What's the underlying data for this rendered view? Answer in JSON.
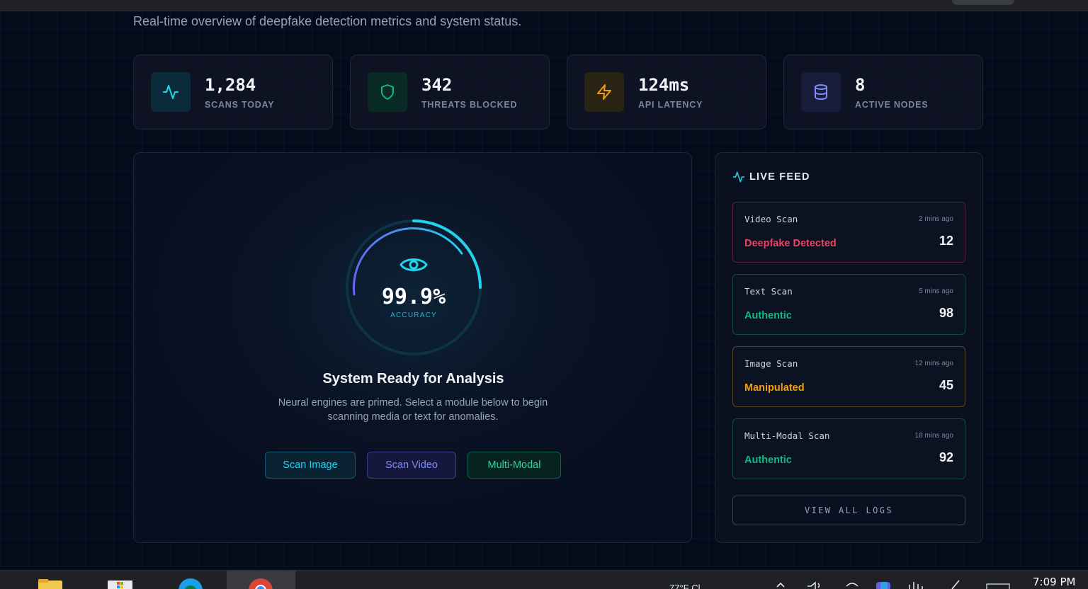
{
  "page": {
    "subtitle": "Real-time overview of deepfake detection metrics and system status."
  },
  "stats": [
    {
      "value": "1,284",
      "label": "SCANS TODAY",
      "icon": "activity-icon",
      "color": "#22d3ee"
    },
    {
      "value": "342",
      "label": "THREATS BLOCKED",
      "icon": "shield-icon",
      "color": "#10b981"
    },
    {
      "value": "124ms",
      "label": "API LATENCY",
      "icon": "lightning-icon",
      "color": "#f59e0b"
    },
    {
      "value": "8",
      "label": "ACTIVE NODES",
      "icon": "database-icon",
      "color": "#818cf8"
    }
  ],
  "main": {
    "gauge_value": "99.9%",
    "gauge_label": "ACCURACY",
    "title": "System Ready for Analysis",
    "description": "Neural engines are primed. Select a module below to begin scanning media or text for anomalies.",
    "buttons": {
      "scan_image": "Scan Image",
      "scan_video": "Scan Video",
      "multi_modal": "Multi-Modal"
    }
  },
  "feed": {
    "title": "LIVE FEED",
    "items": [
      {
        "type": "Video Scan",
        "time": "2 mins ago",
        "status": "Deepfake Detected",
        "score": "12",
        "status_color": "#f43f5e",
        "border_color": "#5a1f3a"
      },
      {
        "type": "Text Scan",
        "time": "5 mins ago",
        "status": "Authentic",
        "score": "98",
        "status_color": "#10b981",
        "border_color": "#0f4a45"
      },
      {
        "type": "Image Scan",
        "time": "12 mins ago",
        "status": "Manipulated",
        "score": "45",
        "status_color": "#f59e0b",
        "border_color": "#5a4420"
      },
      {
        "type": "Multi-Modal Scan",
        "time": "18 mins ago",
        "status": "Authentic",
        "score": "92",
        "status_color": "#10b981",
        "border_color": "#0f4a45"
      }
    ],
    "view_all": "VIEW ALL LOGS"
  },
  "taskbar": {
    "weather": "77°F  Cl",
    "clock": "7:09 PM",
    "apps": [
      "file-explorer-icon",
      "store-icon",
      "edge-icon",
      "chrome-icon"
    ]
  }
}
